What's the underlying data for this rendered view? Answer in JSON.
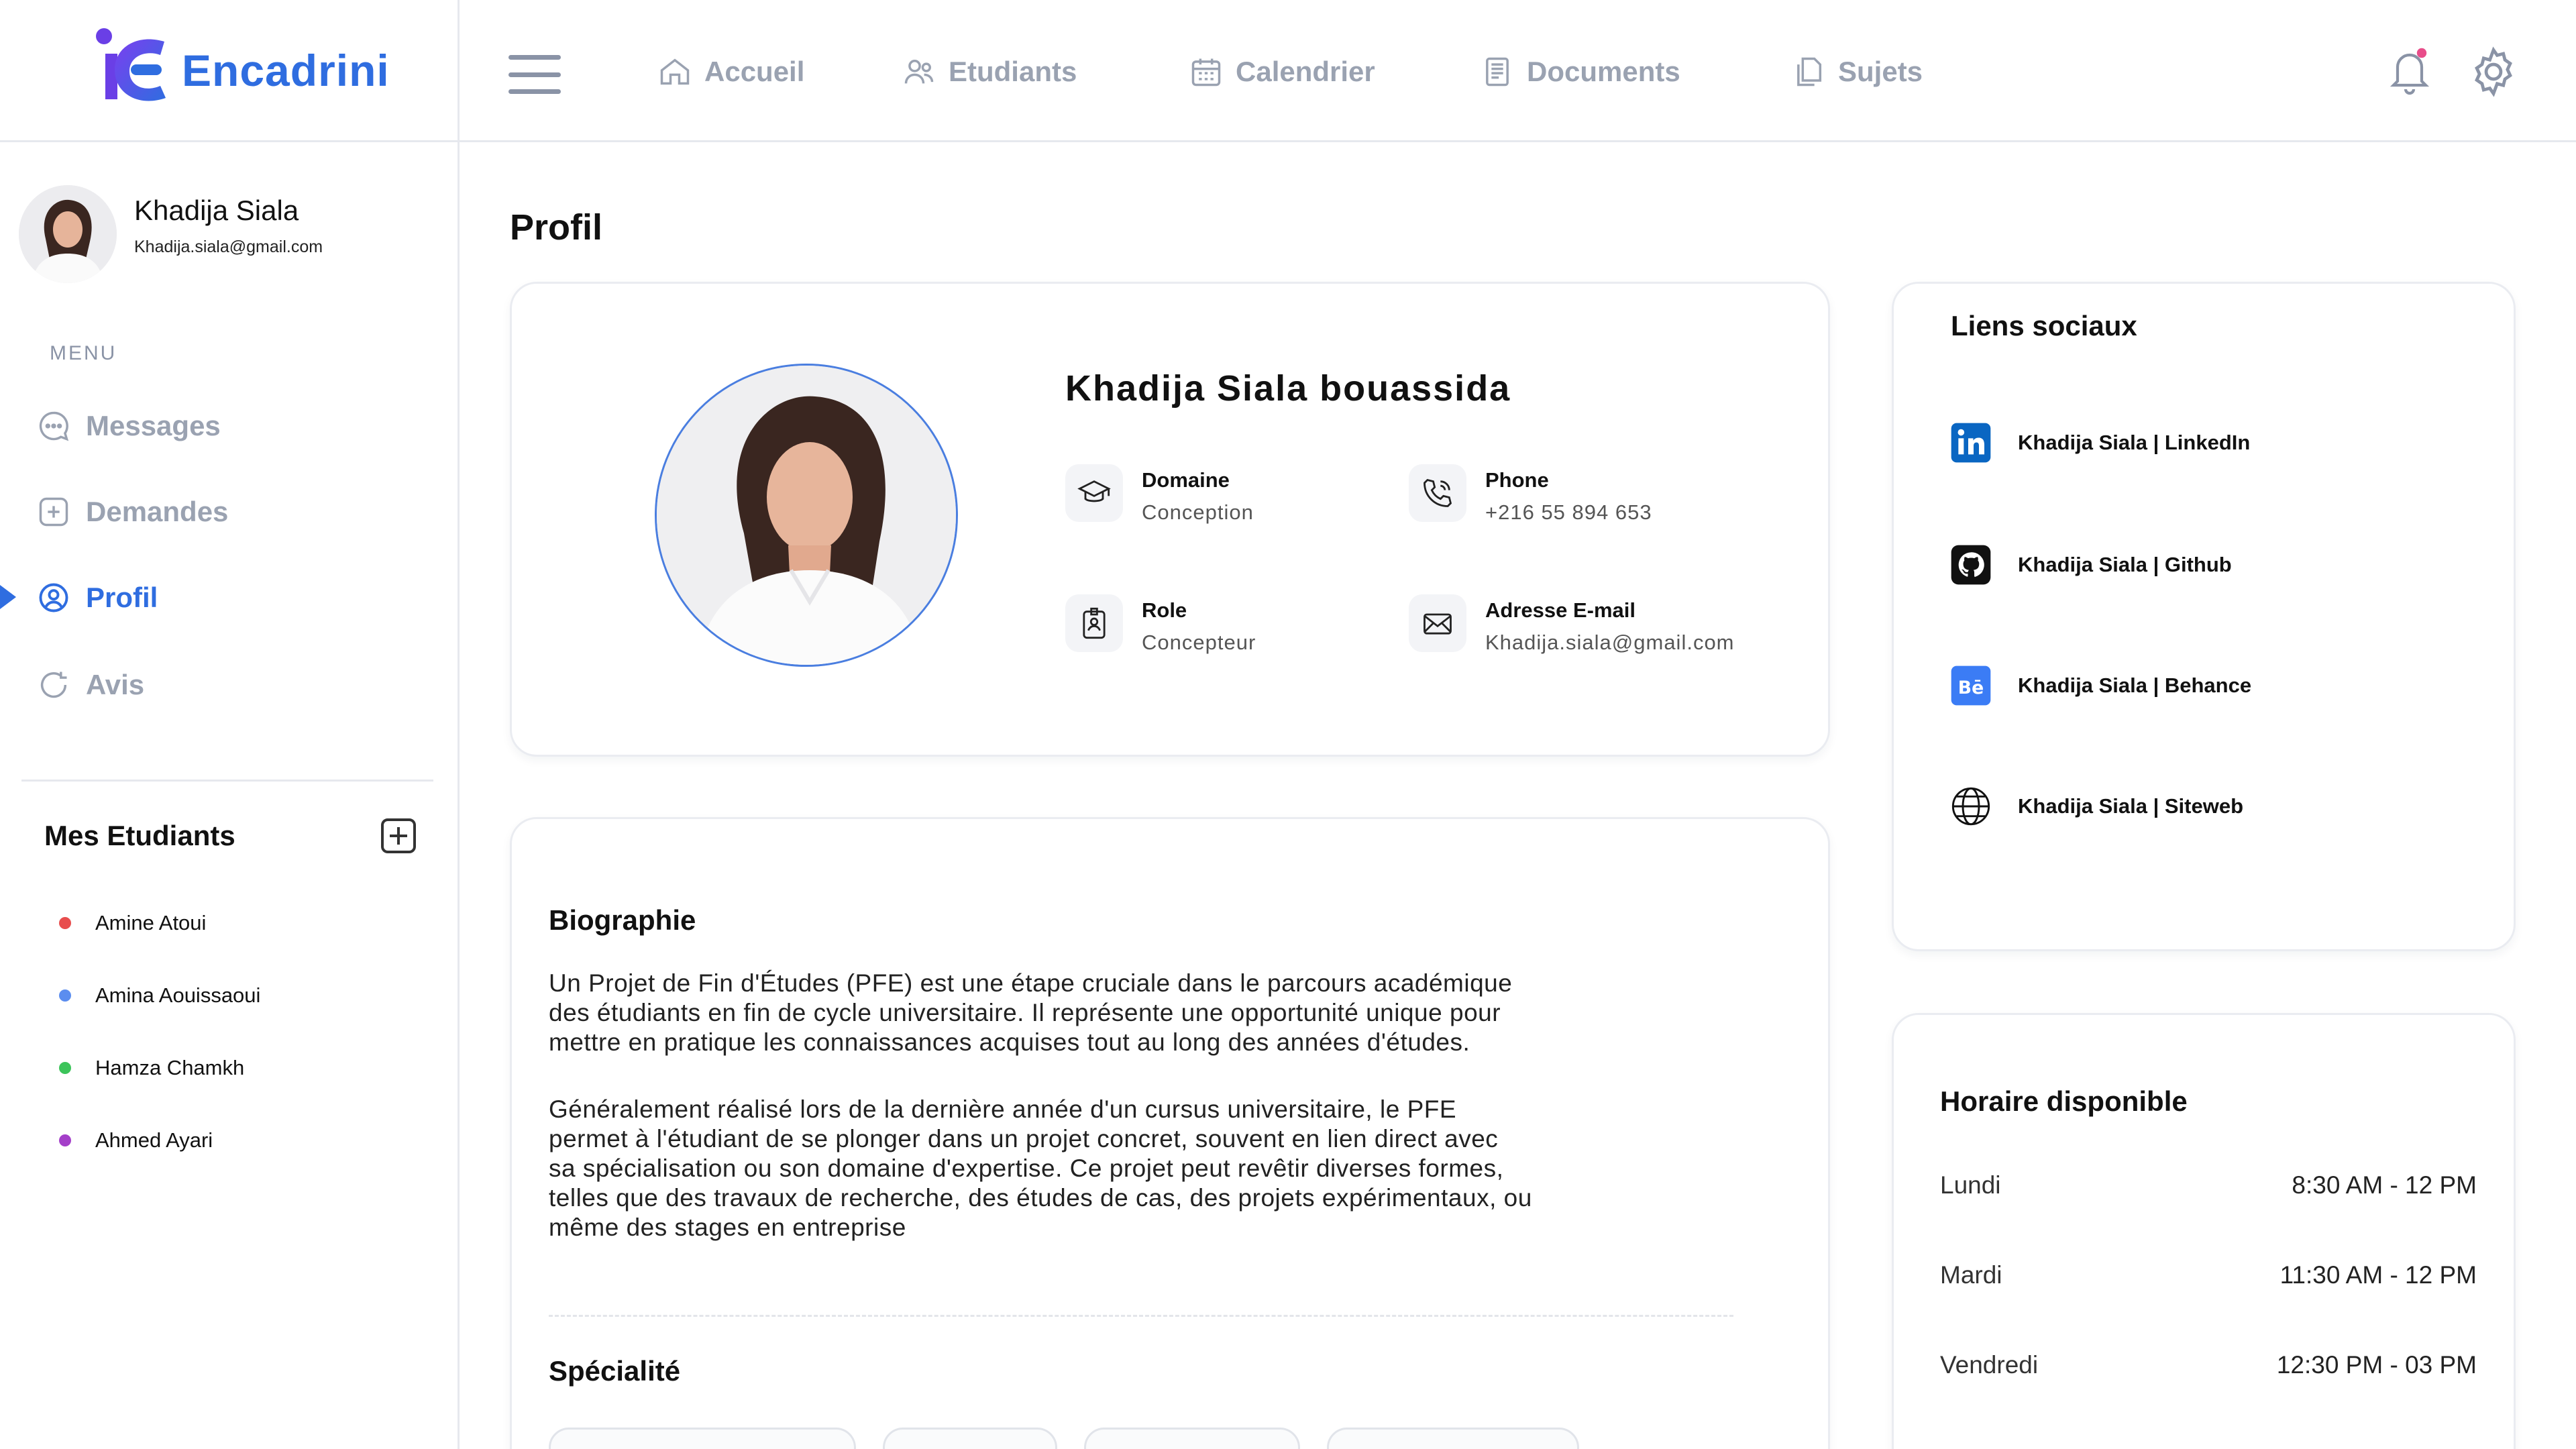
{
  "app": {
    "name": "Encadrini",
    "accent": "#2f6de0"
  },
  "nav": [
    {
      "label": "Accueil",
      "icon": "home-icon"
    },
    {
      "label": "Etudiants",
      "icon": "users-icon"
    },
    {
      "label": "Calendrier",
      "icon": "calendar-icon"
    },
    {
      "label": "Documents",
      "icon": "document-icon"
    },
    {
      "label": "Sujets",
      "icon": "files-icon"
    }
  ],
  "user": {
    "name": "Khadija Siala",
    "email": "Khadija.siala@gmail.com"
  },
  "sidebar": {
    "menu_label": "MENU",
    "items": [
      {
        "label": "Messages",
        "icon": "chat-icon"
      },
      {
        "label": "Demandes",
        "icon": "plus-square-icon"
      },
      {
        "label": "Profil",
        "icon": "user-circle-icon",
        "active": true
      },
      {
        "label": "Avis",
        "icon": "refresh-icon"
      }
    ],
    "students_title": "Mes Etudiants",
    "students": [
      {
        "name": "Amine Atoui",
        "color": "#e84d4d"
      },
      {
        "name": "Amina Aouissaoui",
        "color": "#5b8def"
      },
      {
        "name": "Hamza Chamkh",
        "color": "#3cc45a"
      },
      {
        "name": "Ahmed Ayari",
        "color": "#a43fc9"
      }
    ]
  },
  "page": {
    "title": "Profil"
  },
  "profile": {
    "full_name": "Khadija Siala bouassida",
    "domain_label": "Domaine",
    "domain_value": "Conception",
    "phone_label": "Phone",
    "phone_value": "+216 55 894 653",
    "role_label": "Role",
    "role_value": "Concepteur",
    "email_label": "Adresse E-mail",
    "email_value": "Khadija.siala@gmail.com"
  },
  "bio": {
    "title": "Biographie",
    "p1": [
      "Un Projet de Fin d'Études (PFE) est une étape cruciale dans le parcours académique",
      "des étudiants en fin de cycle universitaire. Il représente une opportunité unique pour",
      "mettre en pratique les connaissances acquises tout au long des années d'études."
    ],
    "p2": [
      "Généralement réalisé lors de la dernière année d'un cursus universitaire, le PFE",
      "permet à l'étudiant de se plonger dans un projet concret, souvent en lien direct avec",
      "sa spécialisation ou son domaine d'expertise. Ce projet peut revêtir diverses formes,",
      "telles que des travaux de recherche, des études de cas, des projets expérimentaux, ou",
      "même des stages en entreprise"
    ],
    "spec_title": "Spécialité"
  },
  "social": {
    "title": "Liens sociaux",
    "links": [
      {
        "label": "Khadija Siala | LinkedIn",
        "icon": "linkedin-icon"
      },
      {
        "label": "Khadija Siala | Github",
        "icon": "github-icon"
      },
      {
        "label": "Khadija Siala | Behance",
        "icon": "behance-icon"
      },
      {
        "label": "Khadija Siala | Siteweb",
        "icon": "globe-icon"
      }
    ]
  },
  "hours": {
    "title": "Horaire disponible",
    "rows": [
      {
        "day": "Lundi",
        "time": "8:30 AM - 12 PM"
      },
      {
        "day": "Mardi",
        "time": "11:30 AM - 12 PM"
      },
      {
        "day": "Vendredi",
        "time": "12:30 PM - 03 PM"
      }
    ]
  }
}
